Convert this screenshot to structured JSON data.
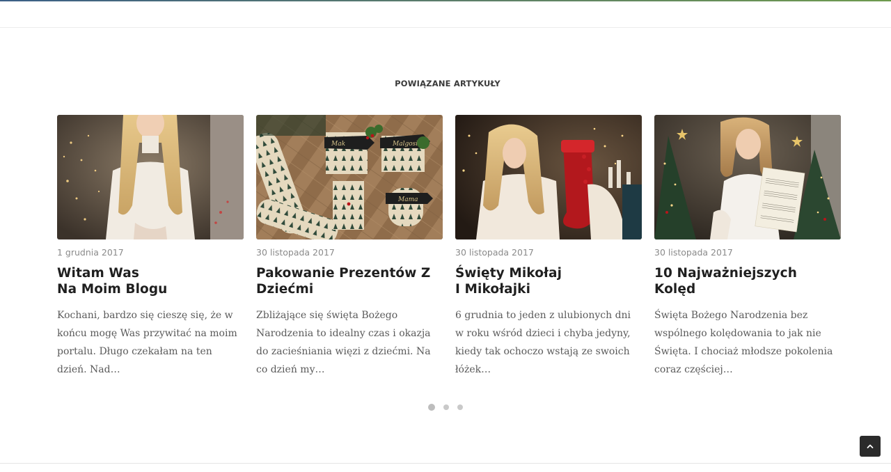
{
  "section": {
    "title": "POWIĄZANE ARTYKUŁY"
  },
  "articles": [
    {
      "date": "1 grudnia 2017",
      "title_lines": [
        "Witam Was",
        "Na Moim Blogu"
      ],
      "excerpt": "Kochani, bardzo się cieszę się, że w końcu mogę Was przywitać na moim portalu. Długo czekałam na ten dzień. Nad…"
    },
    {
      "date": "30 listopada 2017",
      "title_lines": [
        "Pakowanie Prezentów Z",
        "Dziećmi"
      ],
      "excerpt": "Zbliżające się święta Bożego Narodzenia to idealny czas i okazja do zacieśniania więzi z dziećmi. Na co dzień my…"
    },
    {
      "date": "30 listopada 2017",
      "title_lines": [
        "Święty Mikołaj",
        "I Mikołajki"
      ],
      "excerpt": "6 grudnia to jeden z ulubionych dni w roku wśród dzieci i chyba jedyny, kiedy tak ochoczo wstają ze swoich łóżek…"
    },
    {
      "date": "30 listopada 2017",
      "title_lines": [
        "10 Najważniejszych Kolęd"
      ],
      "excerpt": "Święta Bożego Narodzenia bez wspólnego kolędowania to jak nie Święta. I chociaż młodsze pokolenia coraz częściej…"
    }
  ],
  "carousel": {
    "pages": 3,
    "active": 0
  },
  "icons": {
    "back_to_top": "chevron-up-icon"
  },
  "colors": {
    "title": "#1f1f1f",
    "date": "#8a8a8a",
    "excerpt": "#5a5a5a",
    "button": "#2b2b2b"
  }
}
